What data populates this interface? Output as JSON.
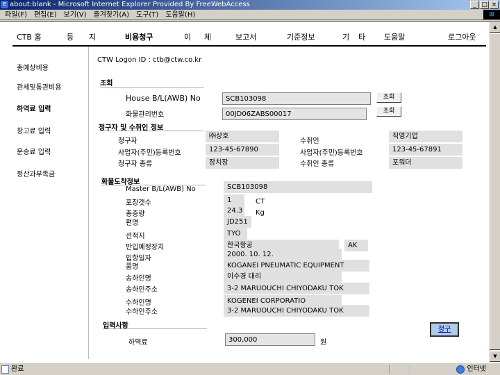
{
  "window": {
    "title": "about:blank - Microsoft Internet Explorer Provided By FreeWebAccess",
    "menu": [
      "파일(F)",
      "편집(E)",
      "보기(V)",
      "즐겨찾기(A)",
      "도구(T)",
      "도움말(H)"
    ],
    "buttons": [
      "_",
      "□",
      "×"
    ]
  },
  "nav": {
    "items": [
      "CTB 홈",
      "등",
      "지",
      "비용청구",
      "이",
      "체",
      "보고서",
      "기준정보",
      "기",
      "타",
      "도움말",
      "로그아웃"
    ]
  },
  "sidebar": {
    "items": [
      "총예상비용",
      "관세및통관비용",
      "하역료 입력",
      "창고료 입력",
      "운송료 입력",
      "정산과부족금"
    ]
  },
  "logon": "CTW Logon ID : ctb@ctw.co.kr",
  "inquiry": {
    "section": "조회",
    "house_label": "House B/L(AWB) No",
    "house_value": "SCB103098",
    "cargo_label": "화물관리번호",
    "cargo_value": "00JD06ZABS00017",
    "search_btn": "조회"
  },
  "parties": {
    "section": "청구자 및 수취인 정보",
    "claimant_label": "청구자",
    "claimant_value": "㈜상호",
    "claimant_reg_label": "사업자(주민)등록번호",
    "claimant_reg_value": "123-45-67890",
    "claimant_type_label": "청구자 종류",
    "claimant_type_value": "장치장",
    "payee_label": "수취인",
    "payee_value": "직영기업",
    "payee_reg_label": "사업자(주민)등록번호",
    "payee_reg_value": "123-45-67891",
    "payee_type_label": "수취인 종류",
    "payee_type_value": "포워더"
  },
  "cargo": {
    "section": "화물도착정보",
    "master_label": "Master B/L(AWB) No",
    "master_value": "SCB103098",
    "pkg_label": "포장갯수",
    "pkg_value": "1",
    "pkg_unit": "CT",
    "weight_label": "총중량",
    "weight_value": "24.3",
    "weight_unit": "Kg",
    "flight_label": "편명",
    "flight_value": "JD251",
    "port_label": "선적지",
    "port_value": "TYO",
    "storage_label": "반입예정장치",
    "storage_value": "한국항공",
    "storage_code": "AK",
    "arrival_label": "입항일자",
    "arrival_value": "2000. 10. 12.",
    "item_label": "품명",
    "item_value": "KOGANEI PNEUMATIC EQUIPMENT",
    "shipper_label": "송하인명",
    "shipper_value": "이수경 대리",
    "shipper_addr_label": "송하인주소",
    "shipper_addr_value": "3-2 MARUOUCHI CHIYODAKU TOK",
    "consignee_label": "수하인명",
    "consignee_value": "KOGENEI CORPORATIO",
    "consignee_addr_label": "수하인주소",
    "consignee_addr_value": "3-2 MARUOUCHI CHIYODAKU TOK"
  },
  "entry": {
    "section": "입력사항",
    "fee_label": "하역료",
    "fee_value": "300,000",
    "fee_unit": "원",
    "claim_btn": "청구"
  },
  "status": {
    "left": "완료",
    "zone": "인터넷"
  }
}
